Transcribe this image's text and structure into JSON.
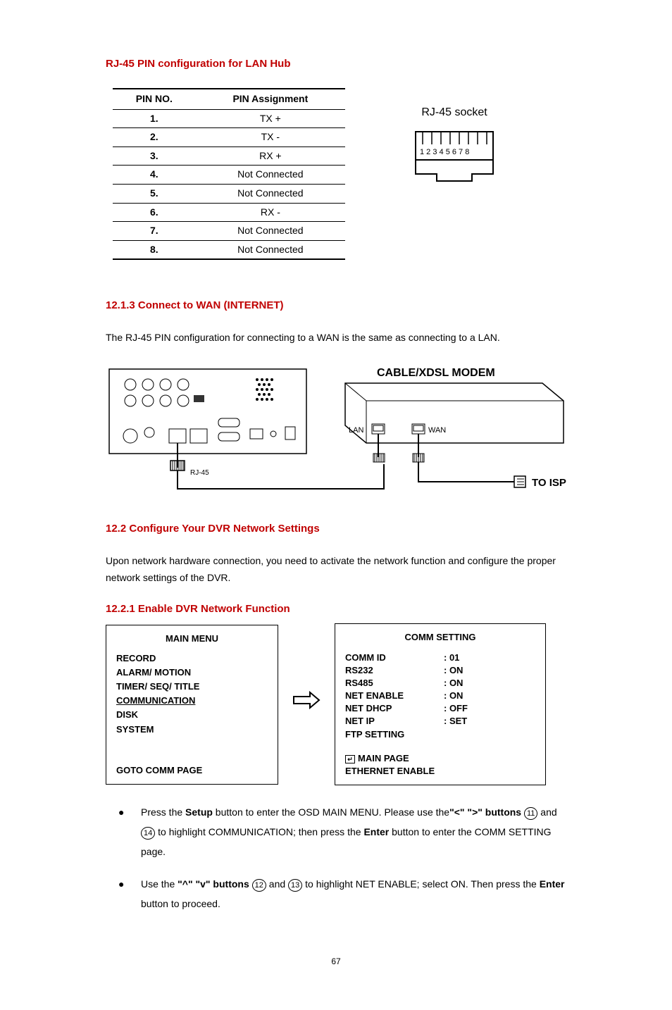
{
  "heading1": "RJ-45 PIN configuration for LAN Hub",
  "pinTable": {
    "headers": [
      "PIN NO.",
      "PIN Assignment"
    ],
    "rows": [
      [
        "1.",
        "TX +"
      ],
      [
        "2.",
        "TX -"
      ],
      [
        "3.",
        "RX +"
      ],
      [
        "4.",
        "Not Connected"
      ],
      [
        "5.",
        "Not Connected"
      ],
      [
        "6.",
        "RX -"
      ],
      [
        "7.",
        "Not Connected"
      ],
      [
        "8.",
        "Not Connected"
      ]
    ]
  },
  "socketLabel": "RJ-45 socket",
  "socketPins": "1 2 3 4 5 6 7 8",
  "heading2": "12.1.3 Connect to WAN (INTERNET)",
  "paragraph2": "The RJ-45 PIN configuration for connecting to a WAN is the same as connecting to a LAN.",
  "diagram": {
    "rj45": "RJ-45",
    "modemTitle": "CABLE/XDSL MODEM",
    "lan": "LAN",
    "wan": "WAN",
    "toIsp": "TO ISP"
  },
  "heading3": "12.2 Configure Your DVR Network Settings",
  "paragraph3": "Upon network hardware connection, you need to activate the network function and configure the proper network settings of the DVR.",
  "heading4": "12.2.1 Enable DVR Network Function",
  "mainMenu": {
    "title": "MAIN MENU",
    "items": [
      "RECORD",
      "ALARM/ MOTION",
      "TIMER/ SEQ/ TITLE",
      "COMMUNICATION",
      "DISK",
      "SYSTEM"
    ],
    "underlined": "COMMUNICATION",
    "bottom": "GOTO COMM PAGE"
  },
  "commSetting": {
    "title": "COMM SETTING",
    "rows": [
      [
        "COMM   ID",
        ": 01"
      ],
      [
        "RS232",
        ": ON"
      ],
      [
        "RS485",
        ": ON"
      ],
      [
        "NET ENABLE",
        ": ON"
      ],
      [
        "NET DHCP",
        ": OFF"
      ],
      [
        "NET IP",
        ": SET"
      ],
      [
        "FTP SETTING",
        ""
      ]
    ],
    "underlined": "NET ENABLE",
    "mainPage": "MAIN PAGE",
    "ethernet": "ETHERNET   ENABLE"
  },
  "bullets": [
    {
      "pre1": "Press the ",
      "bold1": "Setup",
      "mid1": " button to enter the OSD MAIN MENU. Please use the",
      "bold2": "\"<\" \">\" buttons",
      "circ1": "11",
      "mid2": " and ",
      "circ2": "14",
      "post": " to highlight COMMUNICATION; then press the ",
      "bold3": "Enter",
      "end": " button to enter the COMM SETTING page."
    },
    {
      "pre1": "Use the ",
      "bold1": "\"^\" \"v\" buttons",
      "circ1": "12",
      "mid1": " and ",
      "circ2": "13",
      "post": " to highlight NET ENABLE; select ON. Then press the ",
      "bold2": "Enter",
      "end": " button to proceed."
    }
  ],
  "pageNumber": "67"
}
